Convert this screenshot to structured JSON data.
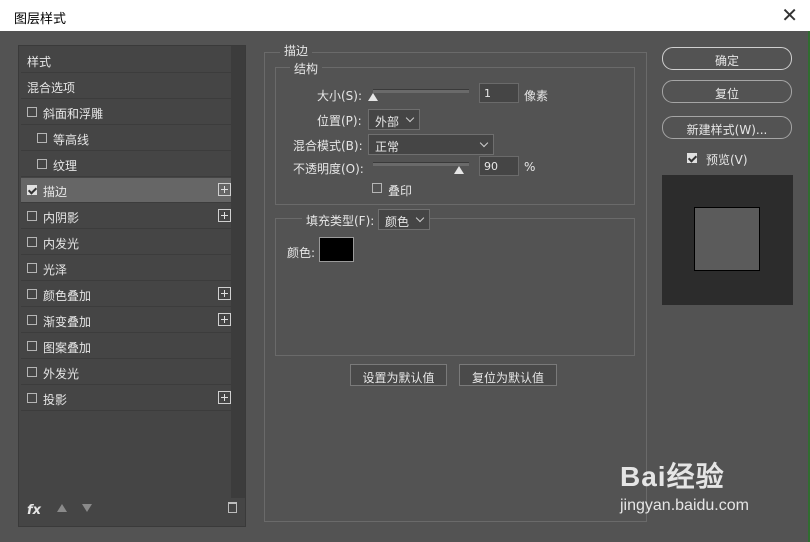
{
  "window": {
    "title": "图层样式"
  },
  "sidebar": {
    "items": [
      {
        "label": "样式",
        "type": "header",
        "checkbox": false,
        "checked": false,
        "plus": false,
        "indent": 0
      },
      {
        "label": "混合选项",
        "type": "header",
        "checkbox": false,
        "checked": false,
        "plus": false,
        "indent": 0
      },
      {
        "label": "斜面和浮雕",
        "checkbox": true,
        "checked": false,
        "plus": false,
        "indent": 0
      },
      {
        "label": "等高线",
        "checkbox": true,
        "checked": false,
        "plus": false,
        "indent": 1
      },
      {
        "label": "纹理",
        "checkbox": true,
        "checked": false,
        "plus": false,
        "indent": 1
      },
      {
        "label": "描边",
        "checkbox": true,
        "checked": true,
        "plus": true,
        "indent": 0,
        "selected": true
      },
      {
        "label": "内阴影",
        "checkbox": true,
        "checked": false,
        "plus": true,
        "indent": 0
      },
      {
        "label": "内发光",
        "checkbox": true,
        "checked": false,
        "plus": false,
        "indent": 0
      },
      {
        "label": "光泽",
        "checkbox": true,
        "checked": false,
        "plus": false,
        "indent": 0
      },
      {
        "label": "颜色叠加",
        "checkbox": true,
        "checked": false,
        "plus": true,
        "indent": 0
      },
      {
        "label": "渐变叠加",
        "checkbox": true,
        "checked": false,
        "plus": true,
        "indent": 0
      },
      {
        "label": "图案叠加",
        "checkbox": true,
        "checked": false,
        "plus": false,
        "indent": 0
      },
      {
        "label": "外发光",
        "checkbox": true,
        "checked": false,
        "plus": false,
        "indent": 0
      },
      {
        "label": "投影",
        "checkbox": true,
        "checked": false,
        "plus": true,
        "indent": 0
      }
    ],
    "bottom": {
      "fx_label": "fx"
    }
  },
  "stroke": {
    "section_title": "描边",
    "structure_title": "结构",
    "size_label": "大小(S):",
    "size_value": "1",
    "size_unit": "像素",
    "size_fraction": 0.0,
    "position_label": "位置(P):",
    "position_value": "外部",
    "blend_label": "混合模式(B):",
    "blend_value": "正常",
    "opacity_label": "不透明度(O):",
    "opacity_value": "90",
    "opacity_unit": "%",
    "opacity_fraction": 0.9,
    "overprint_label": "叠印",
    "overprint_checked": false,
    "fill_type_label": "填充类型(F):",
    "fill_type_value": "颜色",
    "color_label": "颜色:",
    "color_value": "#000000",
    "set_default_label": "设置为默认值",
    "reset_default_label": "复位为默认值"
  },
  "buttons": {
    "ok_label": "确定",
    "reset_label": "复位",
    "new_style_label": "新建样式(W)...",
    "preview_label": "预览(V)",
    "preview_checked": true
  },
  "watermark": {
    "logo": "Bai经验",
    "url": "jingyan.baidu.com"
  }
}
